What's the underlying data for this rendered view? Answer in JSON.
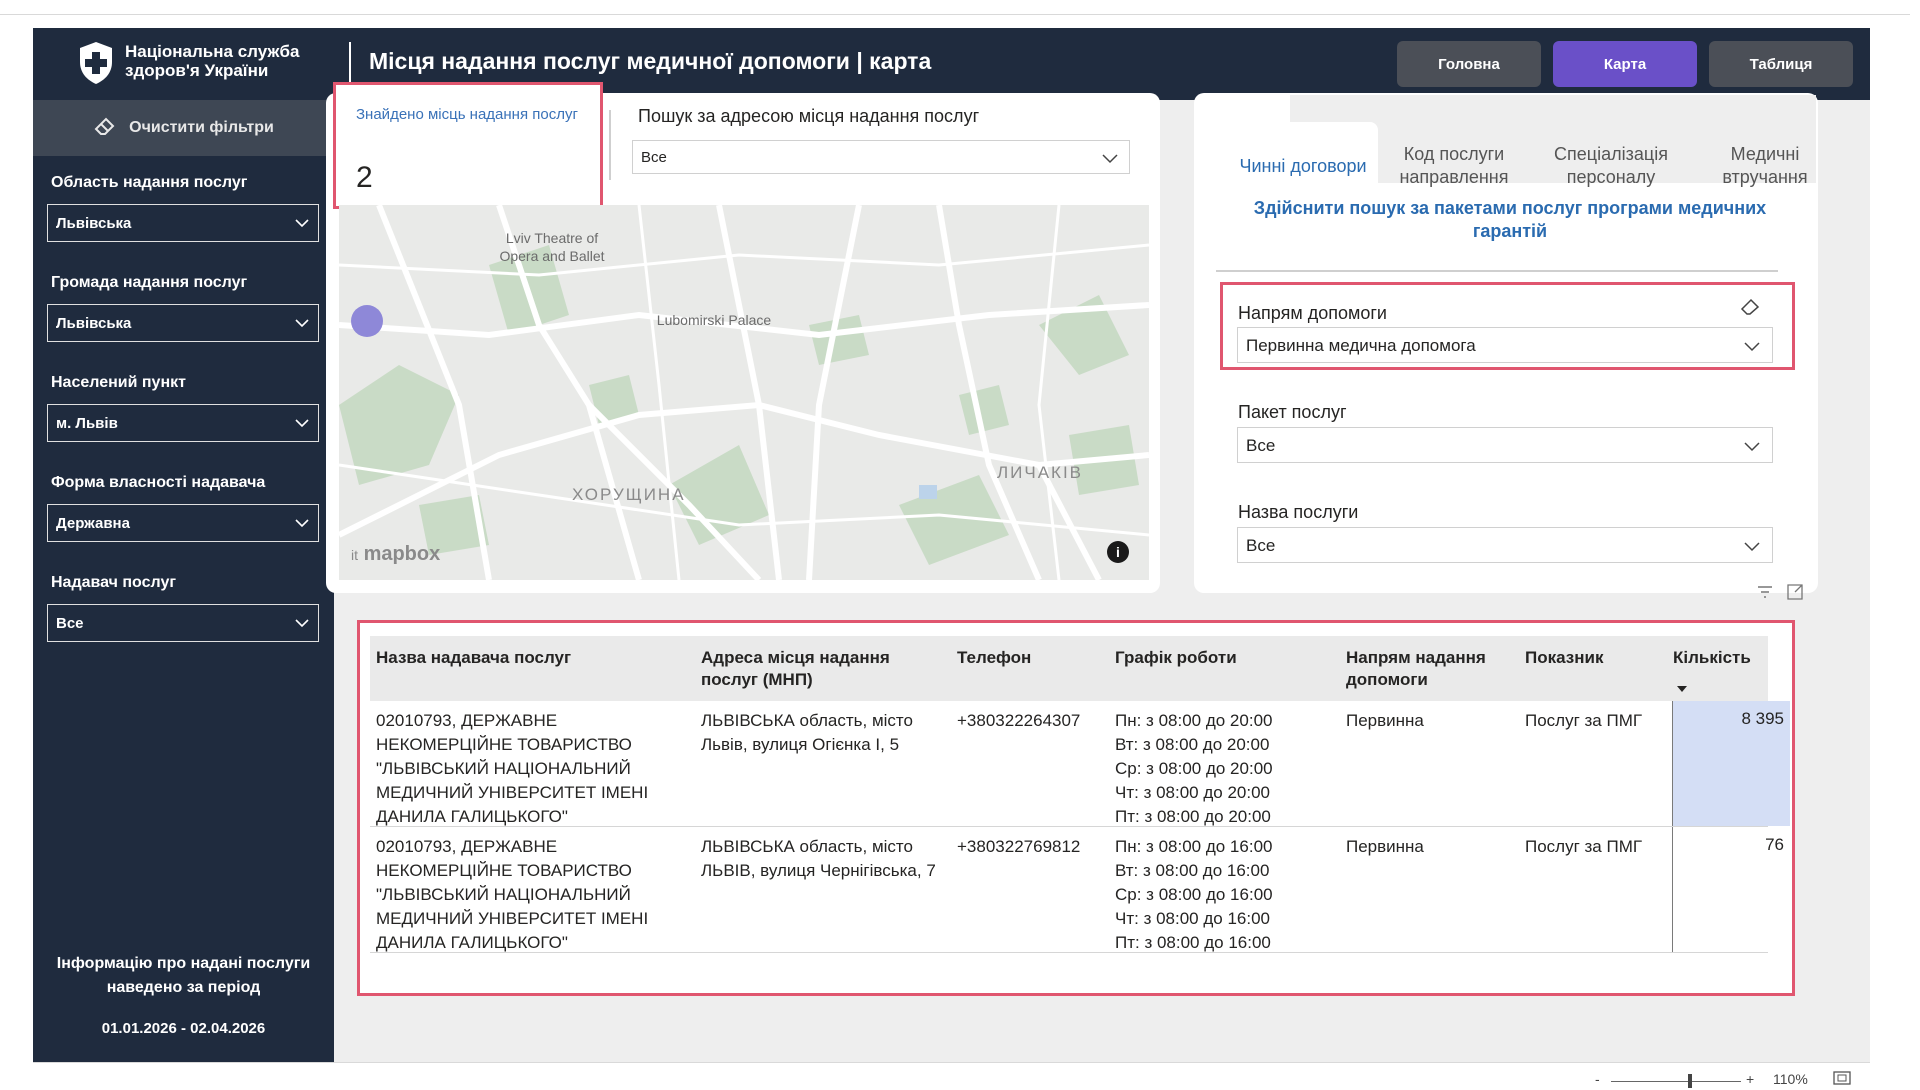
{
  "header": {
    "org_name": "Національна служба здоров'я України",
    "page_title": "Місця надання послуг медичної допомоги | карта",
    "nav": [
      {
        "label": "Головна",
        "active": false
      },
      {
        "label": "Карта",
        "active": true
      },
      {
        "label": "Таблиця",
        "active": false
      }
    ],
    "logo_icon": "shield-cross-icon"
  },
  "sidebar": {
    "clear_filters_label": "Очистити фільтри",
    "filters": [
      {
        "label": "Область надання послуг",
        "value": "Львівська"
      },
      {
        "label": "Громада надання послуг",
        "value": "Львівська"
      },
      {
        "label": "Населений пункт",
        "value": "м. Львів"
      },
      {
        "label": "Форма власності надавача",
        "value": "Державна"
      },
      {
        "label": "Надавач послуг",
        "value": "Все"
      }
    ],
    "info_text": "Інформацію про надані послуги наведено за період",
    "period": "01.01.2026 - 02.04.2026"
  },
  "summary": {
    "found_label": "Знайдено місць надання послуг",
    "found_value": "2"
  },
  "search": {
    "label": "Пошук за адресою місця надання послуг",
    "value": "Все"
  },
  "map": {
    "labels": {
      "theatre": "Lviv Theatre of Opera and Ballet",
      "palace": "Lubomirski Palace",
      "district1": "ХОРУЩИНА",
      "district2": "ЛИЧАКІВ",
      "brand": "mapbox",
      "brand_prefix": "it"
    },
    "info_icon": "i"
  },
  "right_panel": {
    "tabs": [
      {
        "label": "Чинні договори",
        "active": true
      },
      {
        "label": "Код послуги направлення",
        "active": false
      },
      {
        "label": "Спеціалізація персоналу",
        "active": false
      },
      {
        "label": "Медичні втручання",
        "active": false
      }
    ],
    "package_search_link": "Здійснити пошук за пакетами послуг програми медичних гарантій",
    "filters": [
      {
        "label": "Напрям допомоги",
        "value": "Первинна медична допомога"
      },
      {
        "label": "Пакет послуг",
        "value": "Все"
      },
      {
        "label": "Назва послуги",
        "value": "Все"
      }
    ]
  },
  "table": {
    "columns": [
      "Назва надавача послуг",
      "Адреса місця надання послуг (МНП)",
      "Телефон",
      "Графік роботи",
      "Напрям надання допомоги",
      "Показник",
      "Кількість"
    ],
    "rows": [
      {
        "provider": "02010793, ДЕРЖАВНЕ НЕКОМЕРЦІЙНЕ ТОВАРИСТВО \"ЛЬВІВСЬКИЙ НАЦІОНАЛЬНИЙ МЕДИЧНИЙ УНІВЕРСИТЕТ ІМЕНІ ДАНИЛА ГАЛИЦЬКОГО\"",
        "address": "ЛЬВІВСЬКА область, місто Львів, вулиця Огієнка І, 5",
        "phone": "+380322264307",
        "schedule": [
          "Пн: з 08:00 до 20:00",
          "Вт: з 08:00 до 20:00",
          "Ср: з 08:00 до 20:00",
          "Чт: з 08:00 до 20:00",
          "Пт: з 08:00 до 20:00"
        ],
        "direction": "Первинна",
        "indicator": "Послуг за ПМГ",
        "quantity": "8 395"
      },
      {
        "provider": "02010793, ДЕРЖАВНЕ НЕКОМЕРЦІЙНЕ ТОВАРИСТВО \"ЛЬВІВСЬКИЙ НАЦІОНАЛЬНИЙ МЕДИЧНИЙ УНІВЕРСИТЕТ ІМЕНІ ДАНИЛА ГАЛИЦЬКОГО\"",
        "address": "ЛЬВІВСЬКА область, місто ЛЬВІВ, вулиця Чернігівська, 7",
        "phone": "+380322769812",
        "schedule": [
          "Пн: з 08:00 до 16:00",
          "Вт: з 08:00 до 16:00",
          "Ср: з 08:00 до 16:00",
          "Чт: з 08:00 до 16:00",
          "Пт: з 08:00 до 16:00"
        ],
        "direction": "Первинна",
        "indicator": "Послуг за ПМГ",
        "quantity": "76"
      }
    ]
  },
  "footer": {
    "zoom_minus": "-",
    "zoom_plus": "+",
    "zoom_level": "110%"
  },
  "colors": {
    "header_bg": "#1f2b3e",
    "accent": "#6a50c8",
    "highlight_border": "#e0566f",
    "link": "#2a6bb0"
  }
}
